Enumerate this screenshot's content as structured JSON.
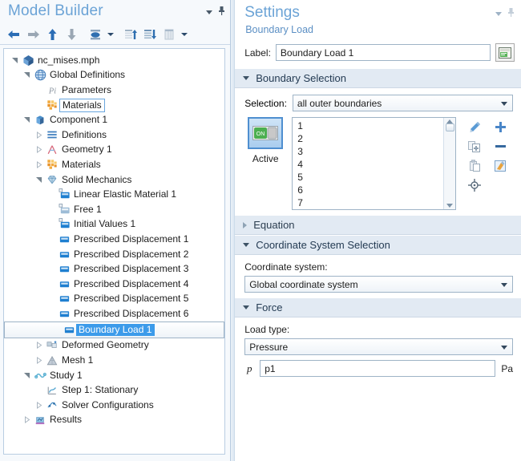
{
  "model_builder": {
    "title": "Model Builder",
    "corner": {
      "dropdown_icon": "chevron-down-icon",
      "pin_icon": "pin-icon"
    },
    "toolbar": [
      {
        "name": "go-back-button",
        "icon": "arrow-left-icon",
        "enabled": true
      },
      {
        "name": "go-forward-button",
        "icon": "arrow-right-icon",
        "enabled": false
      },
      {
        "name": "move-up-button",
        "icon": "arrow-up-icon",
        "enabled": true
      },
      {
        "name": "move-down-button",
        "icon": "arrow-down-icon",
        "enabled": false
      },
      {
        "name": "collapse-all-button",
        "icon": "collapse-icon",
        "enabled": true
      },
      {
        "name": "collapse-menu-caret",
        "icon": "chevron-down-icon",
        "enabled": true
      },
      {
        "name": "expand-tree-button",
        "icon": "list-up-icon",
        "enabled": true
      },
      {
        "name": "collapse-tree-button",
        "icon": "list-down-icon",
        "enabled": true
      },
      {
        "name": "show-list-button",
        "icon": "list-icon",
        "enabled": true
      },
      {
        "name": "show-menu-caret",
        "icon": "chevron-down-icon",
        "enabled": true
      }
    ],
    "tree": [
      {
        "label": "nc_mises.mph",
        "indent": 0,
        "toggle": "open",
        "icon": "model-file-icon",
        "state": "normal"
      },
      {
        "label": "Global Definitions",
        "indent": 1,
        "toggle": "open",
        "icon": "globe-icon",
        "state": "normal"
      },
      {
        "label": "Parameters",
        "indent": 2,
        "toggle": "none",
        "icon": "parameters-pi-icon",
        "state": "normal"
      },
      {
        "label": "Materials",
        "indent": 2,
        "toggle": "none",
        "icon": "materials-icon",
        "state": "outlined"
      },
      {
        "label": "Component 1",
        "indent": 1,
        "toggle": "open",
        "icon": "component-cube-icon",
        "state": "normal"
      },
      {
        "label": "Definitions",
        "indent": 2,
        "toggle": "closed",
        "icon": "definitions-icon",
        "state": "normal"
      },
      {
        "label": "Geometry 1",
        "indent": 2,
        "toggle": "closed",
        "icon": "geometry-icon",
        "state": "normal"
      },
      {
        "label": "Materials",
        "indent": 2,
        "toggle": "closed",
        "icon": "materials-icon",
        "state": "normal"
      },
      {
        "label": "Solid Mechanics",
        "indent": 2,
        "toggle": "open",
        "icon": "solid-mechanics-icon",
        "state": "normal"
      },
      {
        "label": "Linear Elastic Material 1",
        "indent": 3,
        "toggle": "none",
        "icon": "domain-node-icon",
        "state": "normal"
      },
      {
        "label": "Free 1",
        "indent": 3,
        "toggle": "none",
        "icon": "boundary-node-dim-icon",
        "state": "normal"
      },
      {
        "label": "Initial Values 1",
        "indent": 3,
        "toggle": "none",
        "icon": "domain-node-icon",
        "state": "normal"
      },
      {
        "label": "Prescribed Displacement 1",
        "indent": 3,
        "toggle": "none",
        "icon": "boundary-node-icon",
        "state": "normal"
      },
      {
        "label": "Prescribed Displacement 2",
        "indent": 3,
        "toggle": "none",
        "icon": "boundary-node-icon",
        "state": "normal"
      },
      {
        "label": "Prescribed Displacement 3",
        "indent": 3,
        "toggle": "none",
        "icon": "boundary-node-icon",
        "state": "normal"
      },
      {
        "label": "Prescribed Displacement 4",
        "indent": 3,
        "toggle": "none",
        "icon": "boundary-node-icon",
        "state": "normal"
      },
      {
        "label": "Prescribed Displacement 5",
        "indent": 3,
        "toggle": "none",
        "icon": "boundary-node-icon",
        "state": "normal"
      },
      {
        "label": "Prescribed Displacement 6",
        "indent": 3,
        "toggle": "none",
        "icon": "boundary-node-icon",
        "state": "normal"
      },
      {
        "label": "Boundary Load 1",
        "indent": 3,
        "toggle": "none",
        "icon": "boundary-node-icon",
        "state": "selected"
      },
      {
        "label": "Deformed Geometry",
        "indent": 2,
        "toggle": "closed",
        "icon": "deformed-geometry-icon",
        "state": "normal"
      },
      {
        "label": "Mesh 1",
        "indent": 2,
        "toggle": "closed",
        "icon": "mesh-icon",
        "state": "normal"
      },
      {
        "label": "Study 1",
        "indent": 1,
        "toggle": "open",
        "icon": "study-icon",
        "state": "normal"
      },
      {
        "label": "Step 1: Stationary",
        "indent": 2,
        "toggle": "none",
        "icon": "stationary-step-icon",
        "state": "normal"
      },
      {
        "label": "Solver Configurations",
        "indent": 2,
        "toggle": "closed",
        "icon": "solver-icon",
        "state": "normal"
      },
      {
        "label": "Results",
        "indent": 1,
        "toggle": "closed",
        "icon": "results-icon",
        "state": "normal"
      }
    ]
  },
  "settings": {
    "title": "Settings",
    "subtitle": "Boundary Load",
    "corner": {
      "dropdown_icon": "chevron-down-icon",
      "pin_icon": "pin-icon"
    },
    "label_field": {
      "label": "Label:",
      "value": "Boundary Load 1",
      "placeholder": "",
      "button_icon": "rename-description-icon"
    },
    "boundary_selection": {
      "header": "Boundary Selection",
      "expanded": true,
      "selection_label": "Selection:",
      "selection_value": "all outer boundaries",
      "selection_options": [
        "all outer boundaries"
      ],
      "active_button": {
        "label": "Active",
        "icon": "toggle-on-icon"
      },
      "list_items": [
        "1",
        "2",
        "3",
        "4",
        "5",
        "6",
        "7"
      ],
      "tools": [
        {
          "name": "select-box-button",
          "icon": "wand-select-icon",
          "enabled": true
        },
        {
          "name": "add-to-selection-button",
          "icon": "plus-icon",
          "enabled": true
        },
        {
          "name": "copy-selection-button",
          "icon": "copy-icon",
          "enabled": false
        },
        {
          "name": "remove-from-selection-button",
          "icon": "minus-icon",
          "enabled": true
        },
        {
          "name": "paste-selection-button",
          "icon": "paste-icon",
          "enabled": false
        },
        {
          "name": "clear-selection-button",
          "icon": "clear-selection-icon",
          "enabled": true
        },
        {
          "name": "zoom-to-selection-button",
          "icon": "crosshair-icon",
          "enabled": true
        }
      ]
    },
    "equation": {
      "header": "Equation",
      "expanded": false
    },
    "coordinate_system_selection": {
      "header": "Coordinate System Selection",
      "expanded": true,
      "field_label": "Coordinate system:",
      "value": "Global coordinate system",
      "options": [
        "Global coordinate system"
      ]
    },
    "force": {
      "header": "Force",
      "expanded": true,
      "load_type_label": "Load type:",
      "load_type_value": "Pressure",
      "load_type_options": [
        "Pressure"
      ],
      "pressure_symbol": "p",
      "pressure_value": "p1",
      "pressure_unit": "Pa"
    }
  },
  "colors": {
    "accent_blue": "#6ba3d6",
    "selection_blue": "#3c9bea",
    "section_header_bg": "#e2eaf3",
    "panel_bg": "#f6f9fc",
    "border": "#9eb3c6"
  }
}
